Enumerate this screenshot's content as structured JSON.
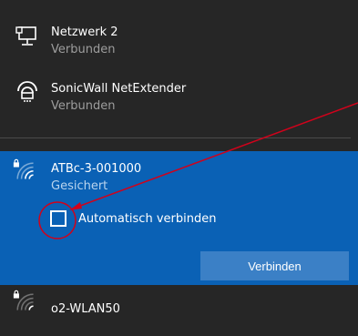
{
  "networks": [
    {
      "name": "Netzwerk 2",
      "status": "Verbunden",
      "icon": "ethernet-monitor-icon"
    },
    {
      "name": "SonicWall NetExtender",
      "status": "Verbunden",
      "icon": "vpn-icon"
    }
  ],
  "selected_network": {
    "name": "ATBc-3-001000",
    "status": "Gesichert",
    "icon": "wifi-secured-icon",
    "auto_connect_label": "Automatisch verbinden",
    "auto_connect_checked": false,
    "connect_label": "Verbinden"
  },
  "other_networks": [
    {
      "name": "o2-WLAN50",
      "icon": "wifi-secured-icon"
    }
  ],
  "colors": {
    "panel_bg": "#262626",
    "selected_bg": "#0a61b5",
    "button_bg": "#3b80c6",
    "annotation_red": "#d0021b"
  }
}
